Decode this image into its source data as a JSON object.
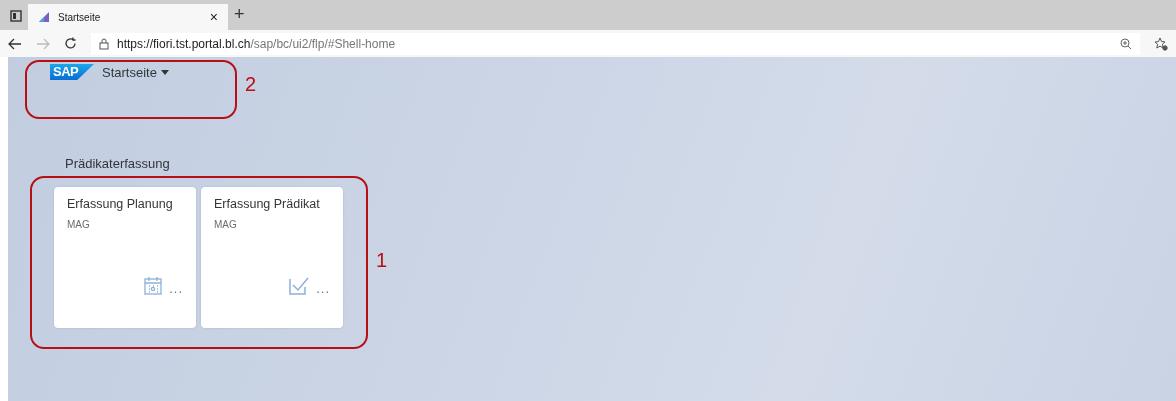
{
  "browser": {
    "tab_title": "Startseite",
    "close": "×",
    "new_tab": "+",
    "url_host": "https://fiori.tst.portal.bl.ch",
    "url_path": "/sap/bc/ui2/flp/#Shell-home"
  },
  "shell": {
    "logo": "SAP",
    "title": "Startseite"
  },
  "group": {
    "title": "Prädikaterfassung",
    "tiles": [
      {
        "title": "Erfassung Planung",
        "subtitle": "MAG",
        "kind": "calendar",
        "more": "..."
      },
      {
        "title": "Erfassung Prädikat",
        "subtitle": "MAG",
        "kind": "check",
        "more": "..."
      }
    ]
  },
  "annotations": [
    {
      "label": "2",
      "kind": "header"
    },
    {
      "label": "1",
      "kind": "tiles"
    }
  ]
}
